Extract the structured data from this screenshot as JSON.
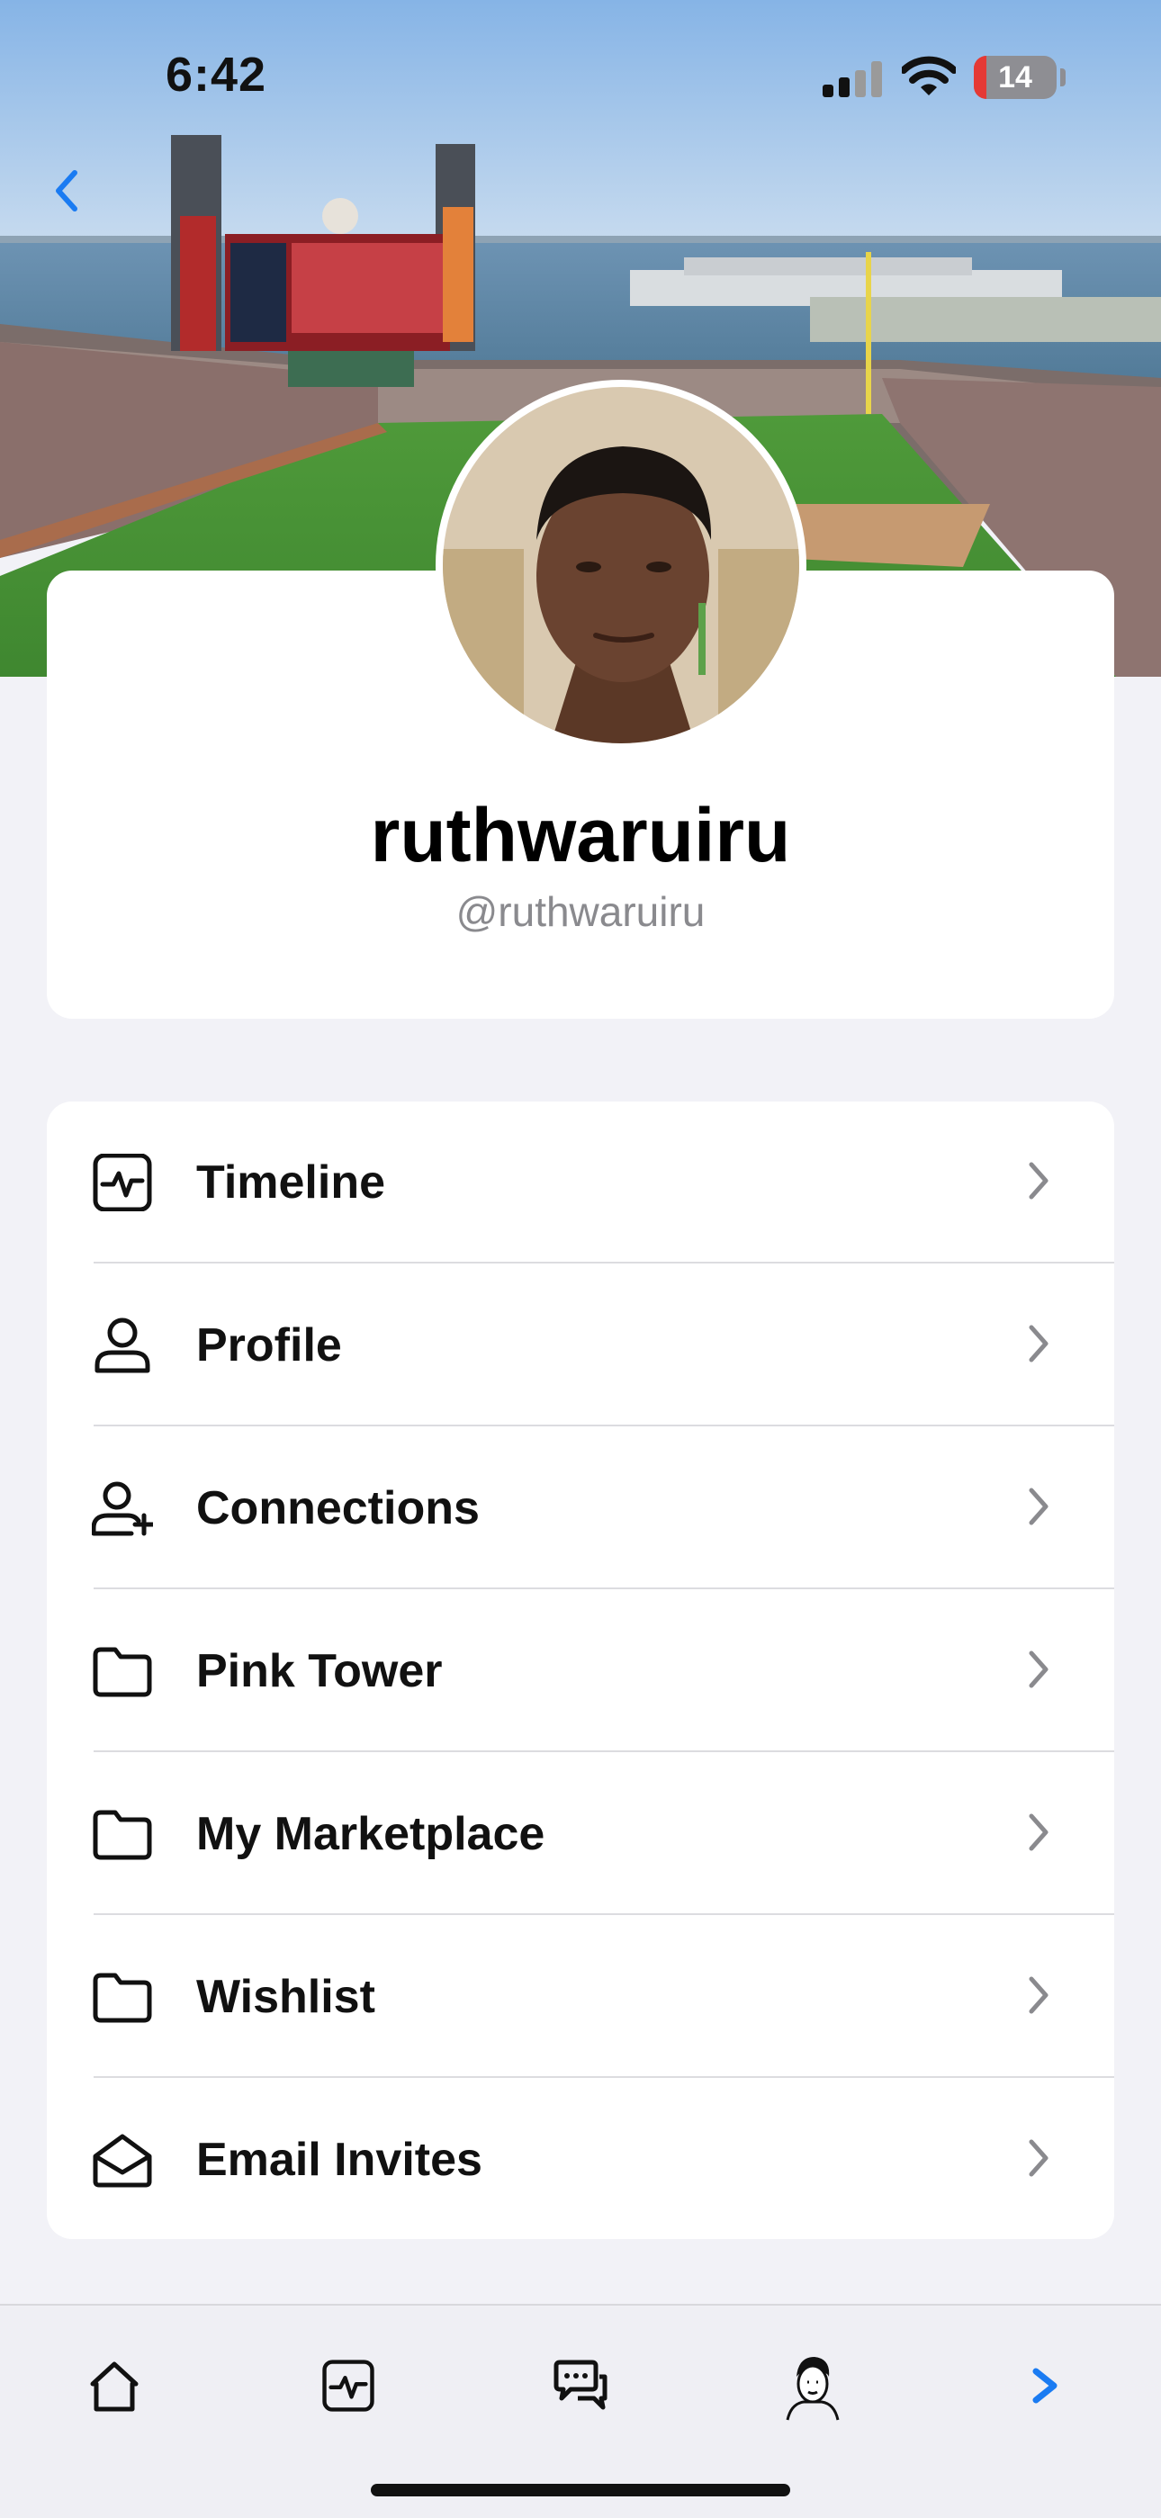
{
  "status_bar": {
    "time": "6:42",
    "battery_percent": "14",
    "signal_bars_filled": 2,
    "signal_bars_total": 4
  },
  "header": {
    "back_icon": "chevron-left-icon",
    "cover_photo": "baseball-stadium"
  },
  "profile": {
    "display_name": "ruthwaruiru",
    "handle": "@ruthwaruiru"
  },
  "menu": {
    "items": [
      {
        "label": "Timeline",
        "icon": "activity-icon"
      },
      {
        "label": "Profile",
        "icon": "person-icon"
      },
      {
        "label": "Connections",
        "icon": "person-add-icon"
      },
      {
        "label": "Pink Tower",
        "icon": "folder-icon"
      },
      {
        "label": "My Marketplace",
        "icon": "folder-icon"
      },
      {
        "label": "Wishlist",
        "icon": "folder-icon"
      },
      {
        "label": "Email Invites",
        "icon": "envelope-open-icon"
      }
    ]
  },
  "tab_bar": {
    "tabs": [
      "home-icon",
      "activity-icon",
      "chat-bubbles-icon",
      "avatar-sketch",
      "chevron-right-icon"
    ]
  },
  "colors": {
    "accent": "#1a7bf2",
    "background": "#f2f2f7",
    "card": "#ffffff",
    "handle_gray": "#8a8a8e"
  }
}
